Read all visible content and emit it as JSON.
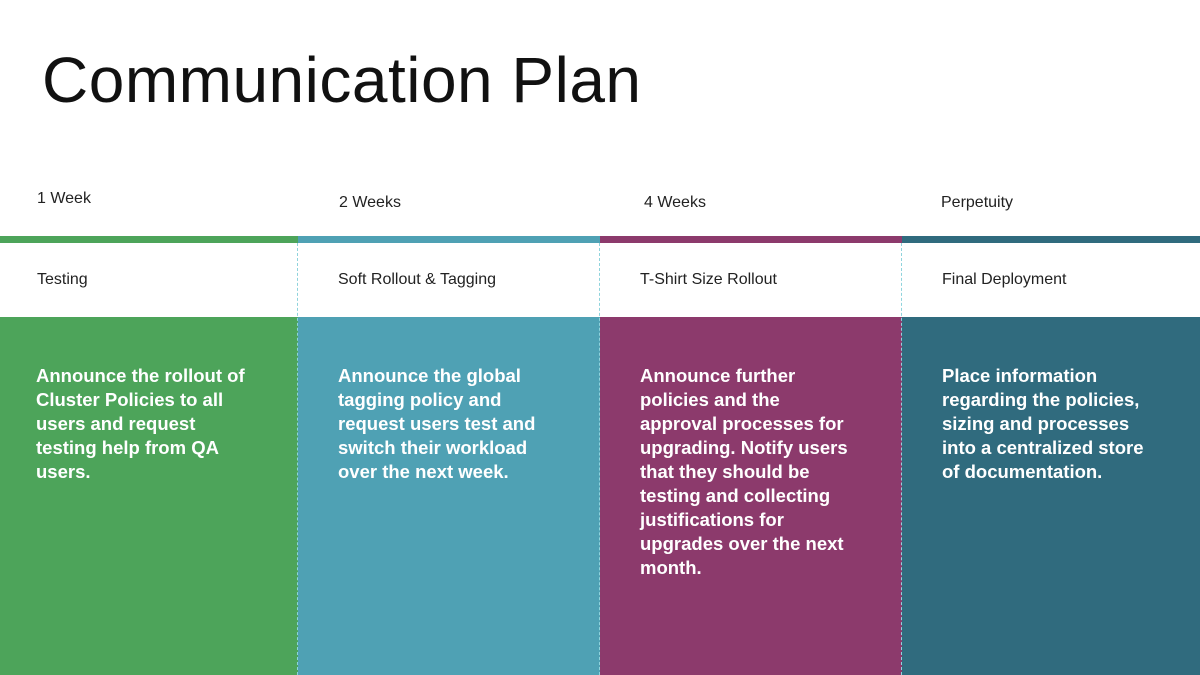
{
  "title": "Communication Plan",
  "columns": [
    {
      "duration": "1 Week",
      "phase": "Testing",
      "description": "Announce the rollout of Cluster Policies to all users and request testing help from QA users.",
      "color": "#4da45a"
    },
    {
      "duration": "2 Weeks",
      "phase": "Soft Rollout & Tagging",
      "description": "Announce the global tagging policy and request users test and switch their workload over the next week.",
      "color": "#4fa1b4"
    },
    {
      "duration": "4 Weeks",
      "phase": "T-Shirt Size Rollout",
      "description": "Announce further policies and the approval processes for upgrading. Notify users that they should be testing and collecting justifications for upgrades over the next month.",
      "color": "#8c3a6c"
    },
    {
      "duration": "Perpetuity",
      "phase": "Final Deployment",
      "description": "Place information regarding the policies, sizing and processes into a centralized store of documentation.",
      "color": "#306b7e"
    }
  ]
}
